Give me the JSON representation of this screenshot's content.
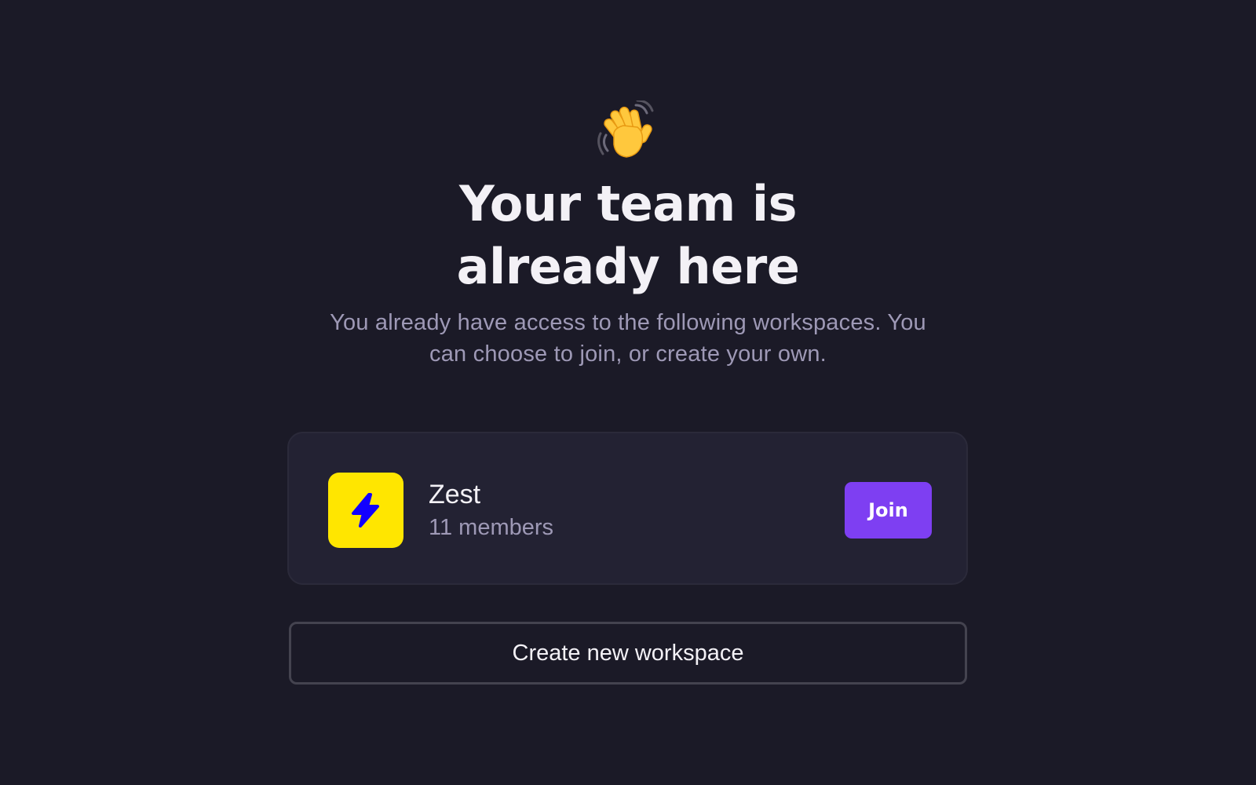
{
  "header": {
    "icon": "waving-hand-icon",
    "title_line1": "Your team is",
    "title_line2": "already here",
    "subtitle_line1": "You already have access to the following workspaces. You",
    "subtitle_line2": "can choose to join, or create your own."
  },
  "workspaces": [
    {
      "name": "Zest",
      "members": "11 members",
      "logo_icon": "lightning-bolt-icon",
      "logo_bg": "#ffe600",
      "logo_fg": "#1200ff",
      "join_label": "Join"
    }
  ],
  "actions": {
    "create_label": "Create new workspace"
  },
  "colors": {
    "background": "#1b1a27",
    "card": "#232233",
    "accent": "#7e3ff2",
    "text_primary": "#f3f1f6",
    "text_secondary": "#9e99b6"
  }
}
